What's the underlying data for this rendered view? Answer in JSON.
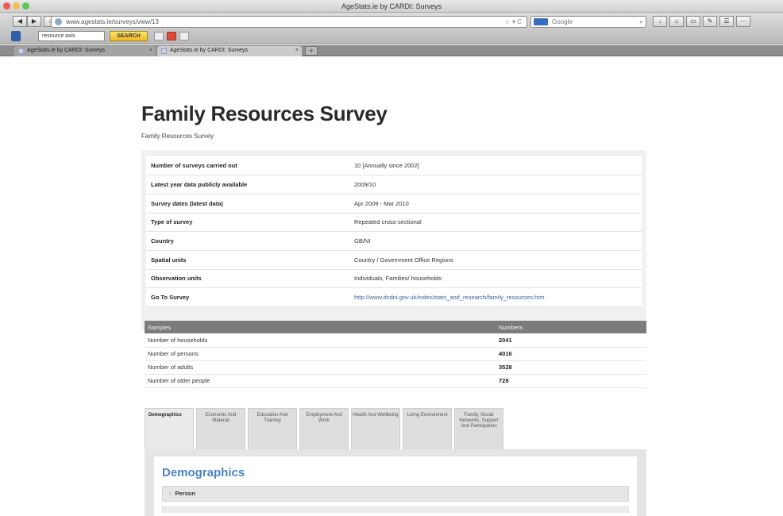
{
  "window": {
    "title": "AgeStats.ie by CARDI: Surveys",
    "traffic_colors": [
      "#ee5b57",
      "#f4bf4f",
      "#61c554"
    ]
  },
  "browser": {
    "url": "www.agestats.ie/surveys/view/13",
    "search_placeholder": "Google",
    "bookmark_select": "resource axis",
    "bookmark_search": "SEARCH",
    "tabs": [
      {
        "label": "AgeStats.ie by CARDI: Surveys"
      },
      {
        "label": "AgeStats.ie by CARDI: Surveys"
      }
    ],
    "newtab_label": "+"
  },
  "page": {
    "title": "Family Resources Survey",
    "subtitle": "Family Resources Survey",
    "info": [
      {
        "key": "Number of surveys carried out",
        "value": "10 [Annually since 2002]"
      },
      {
        "key": "Latest year data publicly available",
        "value": "2009/10"
      },
      {
        "key": "Survey dates (latest data)",
        "value": "Apr 2009 - Mar 2010"
      },
      {
        "key": "Type of survey",
        "value": "Repeated cross-sectional"
      },
      {
        "key": "Country",
        "value": "GB/NI"
      },
      {
        "key": "Spatial units",
        "value": "Country / Government Office Regions"
      },
      {
        "key": "Observation units",
        "value": "Individuals, Families/ households"
      },
      {
        "key": "Go To Survey",
        "value": "http://www.dsdni.gov.uk/index/stats_and_research/family_resources.htm"
      }
    ],
    "samples": {
      "headers": [
        "Samples",
        "Numbers"
      ],
      "rows": [
        {
          "label": "Number of households",
          "value": "2041"
        },
        {
          "label": "Number of persons",
          "value": "4016"
        },
        {
          "label": "Number of adults",
          "value": "3528"
        },
        {
          "label": "Number of older people",
          "value": "728"
        }
      ]
    },
    "topic_tabs": [
      "Demographics",
      "Economic And Material",
      "Education And Training",
      "Employment And Work",
      "Health And Wellbeing",
      "Living Environment",
      "Family, Social Networks, Support And Participation"
    ],
    "panel": {
      "heading": "Demographics",
      "accordion_label": "Person"
    }
  }
}
